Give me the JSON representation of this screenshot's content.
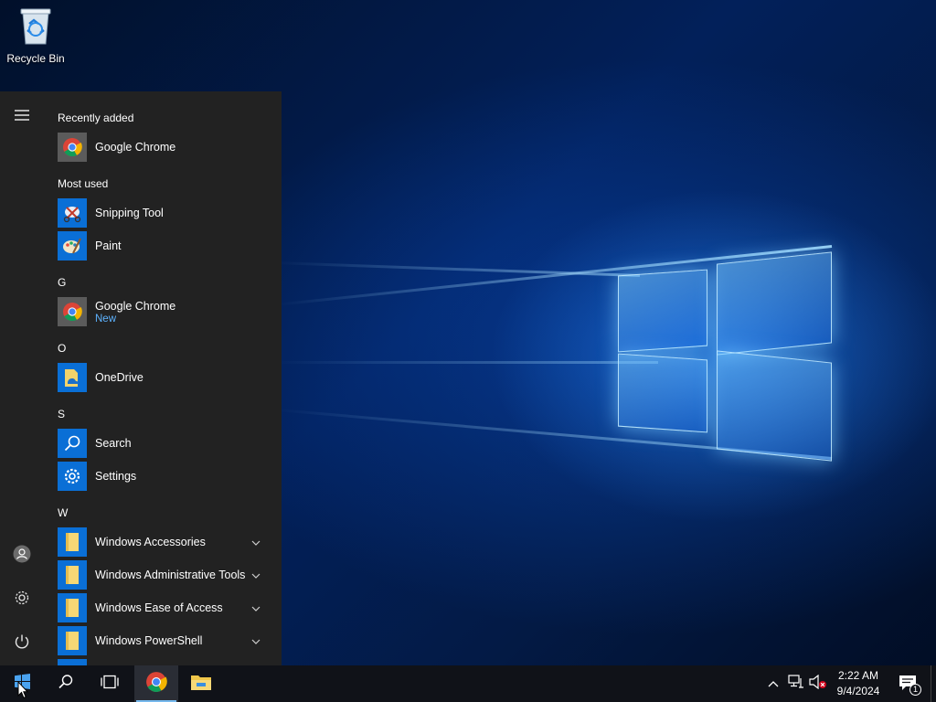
{
  "desktop": {
    "icons": [
      {
        "label": "Recycle Bin",
        "icon": "recycle-bin-icon"
      }
    ]
  },
  "start_menu": {
    "rail": {
      "menu_icon": "hamburger-icon",
      "user_icon": "user-icon",
      "settings_icon": "gear-icon",
      "power_icon": "power-icon"
    },
    "groups": [
      {
        "header": "Recently added",
        "apps": [
          {
            "name": "Google Chrome",
            "icon": "chrome-icon"
          }
        ]
      },
      {
        "header": "Most used",
        "apps": [
          {
            "name": "Snipping Tool",
            "icon": "snipping-tool-icon"
          },
          {
            "name": "Paint",
            "icon": "paint-icon"
          }
        ]
      },
      {
        "header": "G",
        "apps": [
          {
            "name": "Google Chrome",
            "sub": "New",
            "icon": "chrome-icon"
          }
        ]
      },
      {
        "header": "O",
        "apps": [
          {
            "name": "OneDrive",
            "icon": "onedrive-icon"
          }
        ]
      },
      {
        "header": "S",
        "apps": [
          {
            "name": "Search",
            "icon": "search-icon"
          },
          {
            "name": "Settings",
            "icon": "gear-icon"
          }
        ]
      },
      {
        "header": "W",
        "apps": [
          {
            "name": "Windows Accessories",
            "icon": "folder-icon",
            "expandable": true
          },
          {
            "name": "Windows Administrative Tools",
            "icon": "folder-icon",
            "expandable": true
          },
          {
            "name": "Windows Ease of Access",
            "icon": "folder-icon",
            "expandable": true
          },
          {
            "name": "Windows PowerShell",
            "icon": "folder-icon",
            "expandable": true
          }
        ]
      }
    ]
  },
  "taskbar": {
    "buttons": [
      {
        "name": "start",
        "icon": "windows-logo-icon"
      },
      {
        "name": "search",
        "icon": "search-icon"
      },
      {
        "name": "task-view",
        "icon": "task-view-icon"
      },
      {
        "name": "chrome",
        "icon": "chrome-icon",
        "active": true
      },
      {
        "name": "file-explorer",
        "icon": "file-explorer-icon"
      }
    ],
    "tray": {
      "icons": [
        "chevron-up-icon",
        "network-icon",
        "volume-muted-icon"
      ],
      "time": "2:22 AM",
      "date": "9/4/2024",
      "notification_count": "1"
    }
  },
  "colors": {
    "start_menu_bg": "#222222",
    "tile_blue": "#0a6fd6",
    "accent_link": "#5eb3ff",
    "taskbar_bg": "#101218"
  }
}
